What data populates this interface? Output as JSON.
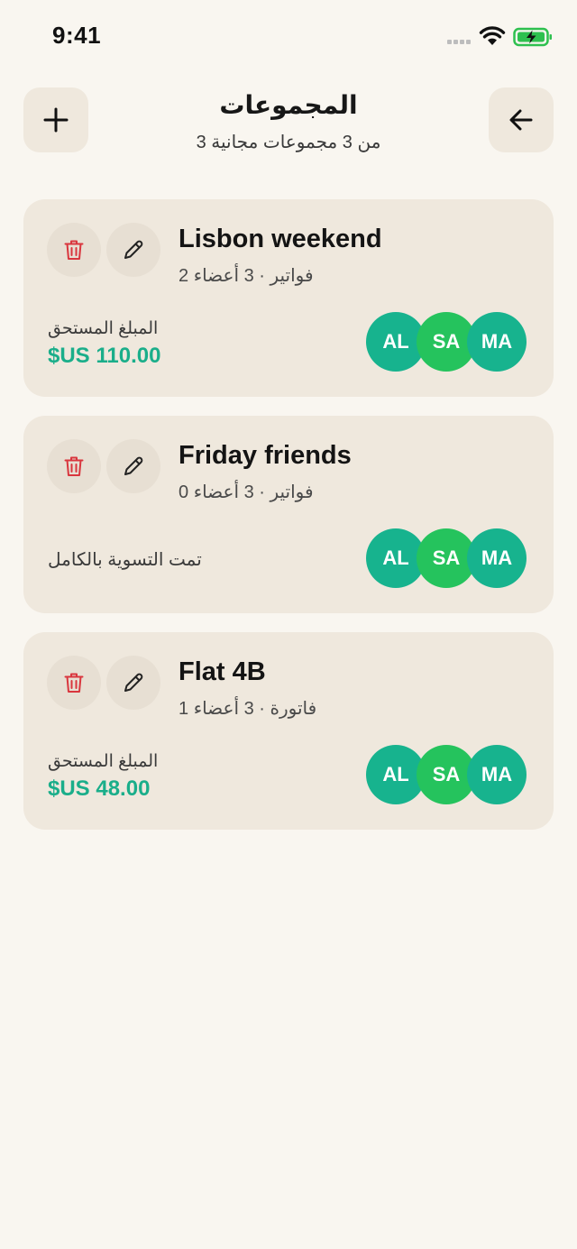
{
  "status_bar": {
    "time": "9:41"
  },
  "header": {
    "title": "المجموعات",
    "subtitle": "3 من 3 مجموعات مجانية"
  },
  "colors": {
    "background": "#f9f6f0",
    "card": "#efe8dd",
    "accent_green": "#1aae8a",
    "avatar_teal": "#17b38e",
    "avatar_green": "#25c35d",
    "delete_red": "#d9363e"
  },
  "icons": {
    "add": "plus-icon",
    "back": "arrow-left-icon",
    "delete": "trash-icon",
    "edit": "pencil-icon"
  },
  "groups": [
    {
      "name": "Lisbon weekend",
      "meta": "2 فواتير · 3 أعضاء",
      "balance_label": "المبلغ المستحق",
      "balance_amount": "$US 110.00",
      "settled_text": "",
      "members": [
        "AL",
        "SA",
        "MA"
      ]
    },
    {
      "name": "Friday friends",
      "meta": "0 فواتير · 3 أعضاء",
      "balance_label": "",
      "balance_amount": "",
      "settled_text": "تمت التسوية بالكامل",
      "members": [
        "AL",
        "SA",
        "MA"
      ]
    },
    {
      "name": "Flat 4B",
      "meta": "1 فاتورة · 3 أعضاء",
      "balance_label": "المبلغ المستحق",
      "balance_amount": "$US 48.00",
      "settled_text": "",
      "members": [
        "AL",
        "SA",
        "MA"
      ]
    }
  ]
}
